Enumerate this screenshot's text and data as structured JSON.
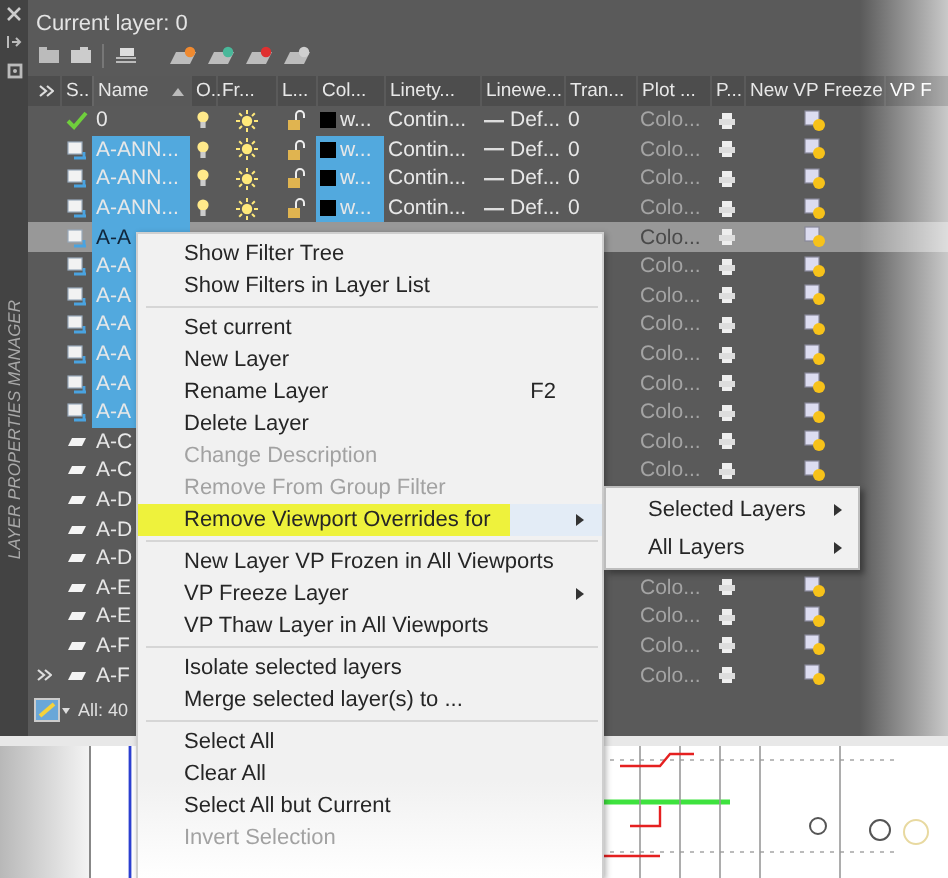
{
  "palette": {
    "side_title": "LAYER PROPERTIES MANAGER",
    "current_layer": "Current layer: 0",
    "columns": [
      {
        "label": "S..",
        "sorted": false
      },
      {
        "label": "Name",
        "sorted": true
      },
      {
        "label": "O..",
        "sorted": false
      },
      {
        "label": "Fr...",
        "sorted": false
      },
      {
        "label": "L...",
        "sorted": false
      },
      {
        "label": "Col...",
        "sorted": false
      },
      {
        "label": "Linety...",
        "sorted": false
      },
      {
        "label": "Linewe...",
        "sorted": false
      },
      {
        "label": "Tran...",
        "sorted": false
      },
      {
        "label": "Plot ...",
        "sorted": false
      },
      {
        "label": "P...",
        "sorted": false
      },
      {
        "label": "New VP Freeze",
        "sorted": false
      },
      {
        "label": "VP F",
        "sorted": false
      }
    ],
    "rows": [
      {
        "kind": "current",
        "name": "0",
        "selected": false,
        "focused": false,
        "on": true,
        "frozen": false,
        "locked": false,
        "color": "#000000",
        "color_label": "w...",
        "linetype": "Contin...",
        "lineweight": "Def...",
        "transparency": "0",
        "plot_style": "Colo...",
        "plot": true,
        "vp_frozen": false
      },
      {
        "kind": "used",
        "name": "A-ANN...",
        "selected": true,
        "focused": false,
        "on": true,
        "frozen": false,
        "locked": false,
        "color": "#000000",
        "color_label": "w...",
        "linetype": "Contin...",
        "lineweight": "Def...",
        "transparency": "0",
        "plot_style": "Colo...",
        "plot": true,
        "vp_frozen": false
      },
      {
        "kind": "used",
        "name": "A-ANN...",
        "selected": true,
        "focused": false,
        "on": true,
        "frozen": false,
        "locked": false,
        "color": "#000000",
        "color_label": "w...",
        "linetype": "Contin...",
        "lineweight": "Def...",
        "transparency": "0",
        "plot_style": "Colo...",
        "plot": true,
        "vp_frozen": false
      },
      {
        "kind": "used",
        "name": "A-ANN...",
        "selected": true,
        "focused": false,
        "on": true,
        "frozen": false,
        "locked": false,
        "color": "#000000",
        "color_label": "w...",
        "linetype": "Contin...",
        "lineweight": "Def...",
        "transparency": "0",
        "plot_style": "Colo...",
        "plot": true,
        "vp_frozen": false
      },
      {
        "kind": "used",
        "name": "A-A",
        "selected": true,
        "focused": true,
        "plot_style": "Colo...",
        "plot": true,
        "vp_frozen": false
      },
      {
        "kind": "used",
        "name": "A-A",
        "selected": true,
        "focused": false,
        "plot_style": "Colo...",
        "plot": true,
        "vp_frozen": false
      },
      {
        "kind": "used",
        "name": "A-A",
        "selected": true,
        "focused": false,
        "plot_style": "Colo...",
        "plot": true,
        "vp_frozen": false
      },
      {
        "kind": "used",
        "name": "A-A",
        "selected": true,
        "focused": false,
        "plot_style": "Colo...",
        "plot": true,
        "vp_frozen": false
      },
      {
        "kind": "used",
        "name": "A-A",
        "selected": true,
        "focused": false,
        "plot_style": "Colo...",
        "plot": true,
        "vp_frozen": false
      },
      {
        "kind": "used",
        "name": "A-A",
        "selected": true,
        "focused": false,
        "plot_style": "Colo...",
        "plot": true,
        "vp_frozen": false
      },
      {
        "kind": "used",
        "name": "A-A",
        "selected": true,
        "focused": false,
        "plot_style": "Colo...",
        "plot": true,
        "vp_frozen": false
      },
      {
        "kind": "unused",
        "name": "A-C",
        "selected": false,
        "focused": false,
        "plot_style": "Colo...",
        "plot": true,
        "vp_frozen": false
      },
      {
        "kind": "unused",
        "name": "A-C",
        "selected": false,
        "focused": false,
        "plot_style": "Colo...",
        "plot": true,
        "vp_frozen": false
      },
      {
        "kind": "unused",
        "name": "A-D",
        "selected": false,
        "focused": false
      },
      {
        "kind": "unused",
        "name": "A-D",
        "selected": false,
        "focused": false
      },
      {
        "kind": "unused",
        "name": "A-D",
        "selected": false,
        "focused": false
      },
      {
        "kind": "unused",
        "name": "A-E",
        "selected": false,
        "focused": false,
        "plot_style": "Colo...",
        "plot": true,
        "vp_frozen": false
      },
      {
        "kind": "unused",
        "name": "A-E",
        "selected": false,
        "focused": false,
        "plot_style": "Colo...",
        "plot": true,
        "vp_frozen": false
      },
      {
        "kind": "unused",
        "name": "A-F",
        "selected": false,
        "focused": false,
        "plot_style": "Colo...",
        "plot": true,
        "vp_frozen": false
      },
      {
        "kind": "unused",
        "name": "A-F",
        "selected": false,
        "focused": false,
        "plot_style": "Colo...",
        "plot": true,
        "vp_frozen": false
      }
    ],
    "status": "All: 40"
  },
  "context_menu": {
    "items": [
      {
        "kind": "item",
        "label": "Show Filter Tree",
        "disabled": false,
        "highlighted": false,
        "submenu": false
      },
      {
        "kind": "item",
        "label": "Show Filters in Layer List",
        "disabled": false,
        "highlighted": false,
        "submenu": false
      },
      {
        "kind": "separator"
      },
      {
        "kind": "item",
        "label": "Set current",
        "disabled": false,
        "highlighted": false,
        "submenu": false
      },
      {
        "kind": "item",
        "label": "New Layer",
        "disabled": false,
        "highlighted": false,
        "submenu": false
      },
      {
        "kind": "item",
        "label": "Rename Layer",
        "shortcut": "F2",
        "disabled": false,
        "highlighted": false,
        "submenu": false
      },
      {
        "kind": "item",
        "label": "Delete Layer",
        "disabled": false,
        "highlighted": false,
        "submenu": false
      },
      {
        "kind": "item",
        "label": "Change Description",
        "disabled": true,
        "highlighted": false,
        "submenu": false
      },
      {
        "kind": "item",
        "label": "Remove From Group Filter",
        "disabled": true,
        "highlighted": false,
        "submenu": false
      },
      {
        "kind": "item",
        "label": "Remove Viewport Overrides for",
        "disabled": false,
        "highlighted": true,
        "submenu": true
      },
      {
        "kind": "separator"
      },
      {
        "kind": "item",
        "label": "New Layer VP Frozen in All Viewports",
        "disabled": false,
        "highlighted": false,
        "submenu": false
      },
      {
        "kind": "item",
        "label": "VP Freeze Layer",
        "disabled": false,
        "highlighted": false,
        "submenu": true
      },
      {
        "kind": "item",
        "label": "VP Thaw Layer in All Viewports",
        "disabled": false,
        "highlighted": false,
        "submenu": false
      },
      {
        "kind": "separator"
      },
      {
        "kind": "item",
        "label": "Isolate selected layers",
        "disabled": false,
        "highlighted": false,
        "submenu": false
      },
      {
        "kind": "item",
        "label": "Merge selected layer(s) to ...",
        "disabled": false,
        "highlighted": false,
        "submenu": false
      },
      {
        "kind": "separator"
      },
      {
        "kind": "item",
        "label": "Select All",
        "disabled": false,
        "highlighted": false,
        "submenu": false
      },
      {
        "kind": "item",
        "label": "Clear All",
        "disabled": false,
        "highlighted": false,
        "submenu": false
      },
      {
        "kind": "item",
        "label": "Select All but Current",
        "disabled": false,
        "highlighted": false,
        "submenu": false
      },
      {
        "kind": "item",
        "label": "Invert Selection",
        "disabled": true,
        "highlighted": false,
        "submenu": false
      }
    ]
  },
  "submenu": {
    "items": [
      {
        "label": "Selected Layers",
        "submenu": true
      },
      {
        "label": "All Layers",
        "submenu": true
      }
    ]
  }
}
